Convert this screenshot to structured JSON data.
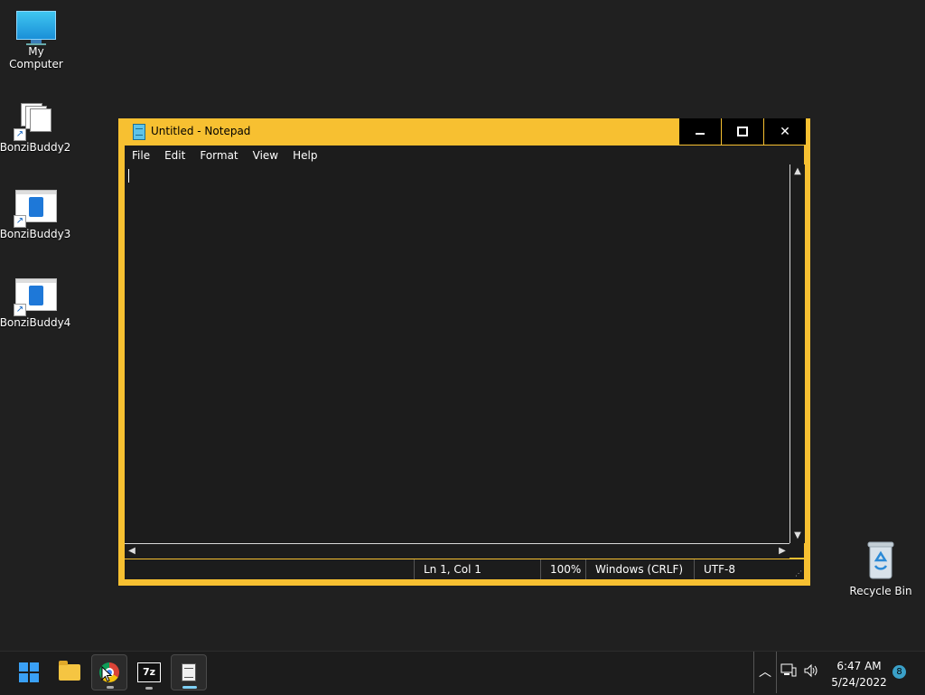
{
  "desktop": {
    "icons": [
      {
        "label": "My Computer"
      },
      {
        "label": "BonziBuddy2"
      },
      {
        "label": "BonziBuddy3"
      },
      {
        "label": "BonziBuddy4"
      },
      {
        "label": "Recycle Bin"
      }
    ]
  },
  "notepad": {
    "title": "Untitled - Notepad",
    "menu": [
      "File",
      "Edit",
      "Format",
      "View",
      "Help"
    ],
    "content": "",
    "status": {
      "position": "Ln 1, Col 1",
      "zoom": "100%",
      "line_ending": "Windows (CRLF)",
      "encoding": "UTF-8"
    },
    "accent_color": "#f7c031"
  },
  "taskbar": {
    "apps": [
      "start-icon",
      "file-explorer-icon",
      "chrome-icon",
      "7zip-icon",
      "notepad-icon"
    ],
    "sevenzip_label": "7z",
    "clock_time": "6:47 AM",
    "clock_date": "5/24/2022",
    "notification_count": "8"
  }
}
